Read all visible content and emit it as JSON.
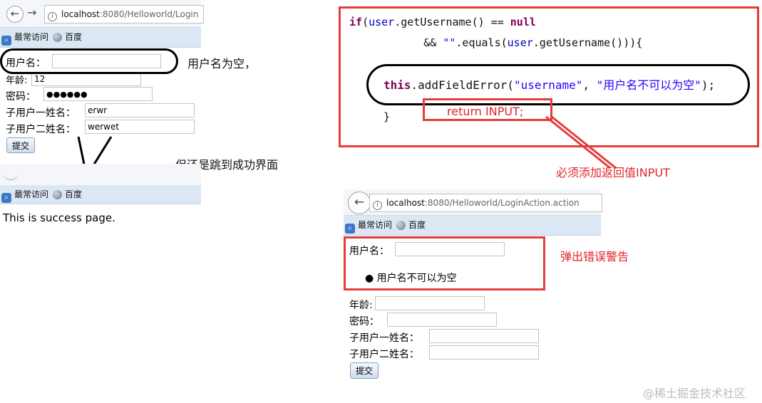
{
  "top_left": {
    "url_host": "localhost",
    "url_rest": ":8080/Helloworld/Login",
    "bookmarks": [
      "最常访问",
      "百度"
    ],
    "form": {
      "username_label": "用户名：",
      "username_value": "",
      "age_label": "年龄:",
      "age_value": "12",
      "password_label": "密码：",
      "password_value": "●●●●●●",
      "sub1_label": "子用户一姓名：",
      "sub1_value": "erwr",
      "sub2_label": "子用户二姓名：",
      "sub2_value": "werwet",
      "submit_label": "提交"
    },
    "note_empty": "用户名为空，"
  },
  "success": {
    "note": "但还是跳到成功界面",
    "bookmarks": [
      "最常访问",
      "百度"
    ],
    "page_text": "This is success page."
  },
  "code": {
    "line1_kw": "if",
    "line1_rest_a": "(",
    "line1_field": "user",
    "line1_rest_b": ".getUsername() == ",
    "line1_null": "null",
    "line2_a": "        && ",
    "line2_str": "\"\"",
    "line2_b": ".equals(",
    "line2_field": "user",
    "line2_c": ".getUsername())){",
    "line3_kw": "this",
    "line3_a": ".addFieldError(",
    "line3_str1": "\"username\"",
    "line3_b": ", ",
    "line3_str2": "\"用户名不可以为空\"",
    "line3_c": ");",
    "line4": "}",
    "return_text": "return INPUT;"
  },
  "callout_return": "必须添加返回值INPUT",
  "bottom": {
    "url_host": "localhost",
    "url_rest": ":8080/Helloworld/LoginAction.action",
    "bookmarks": [
      "最常访问",
      "百度"
    ],
    "form": {
      "username_label": "用户名：",
      "error_item": "用户名不可以为空",
      "age_label": "年龄:",
      "password_label": "密码：",
      "sub1_label": "子用户一姓名：",
      "sub2_label": "子用户二姓名：",
      "submit_label": "提交"
    },
    "note_error": "弹出错误警告"
  },
  "watermark": "@稀土掘金技术社区",
  "colors": {
    "annotation_red": "#e53b3b",
    "keyword": "#7f0055",
    "field": "#0000c0",
    "string": "#2a00ff"
  }
}
